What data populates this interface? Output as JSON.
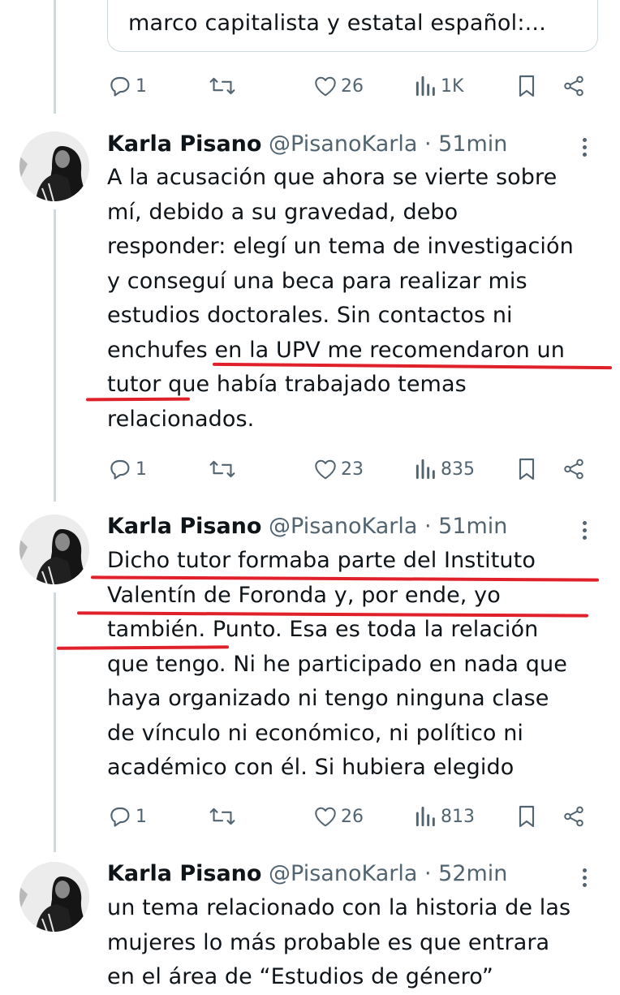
{
  "quote": {
    "text": "marco capitalista y estatal español:..."
  },
  "top_actions": {
    "replies": "1",
    "likes": "26",
    "views": "1K"
  },
  "tweets": [
    {
      "name": "Karla Pisano",
      "handle": "@PisanoKarla",
      "time": "· 51min",
      "lines": [
        "A la acusación que ahora se vierte sobre",
        "mí, debido a su gravedad, debo",
        "responder: elegí un tema de investigación",
        "y conseguí una beca para realizar mis",
        "estudios doctorales. Sin contactos ni",
        "enchufes en la UPV me recomendaron un",
        "tutor que había trabajado temas",
        "relacionados."
      ],
      "replies": "1",
      "likes": "23",
      "views": "835"
    },
    {
      "name": "Karla Pisano",
      "handle": "@PisanoKarla",
      "time": "· 51min",
      "lines": [
        "Dicho tutor formaba parte del Instituto",
        "Valentín de Foronda y, por ende, yo",
        "también. Punto. Esa es toda la relación",
        "que tengo. Ni he participado en nada que",
        "haya organizado ni tengo ninguna clase",
        "de vínculo ni económico, ni político ni",
        "académico con él. Si hubiera elegido"
      ],
      "replies": "1",
      "likes": "26",
      "views": "813"
    },
    {
      "name": "Karla Pisano",
      "handle": "@PisanoKarla",
      "time": "· 52min",
      "lines": [
        "un tema relacionado con la historia de las",
        "mujeres lo más probable es que entrara",
        "en el área de “Estudios de género”"
      ]
    }
  ],
  "colors": {
    "highlight": "#e0202a",
    "text": "#0f1419",
    "muted": "#536471"
  }
}
